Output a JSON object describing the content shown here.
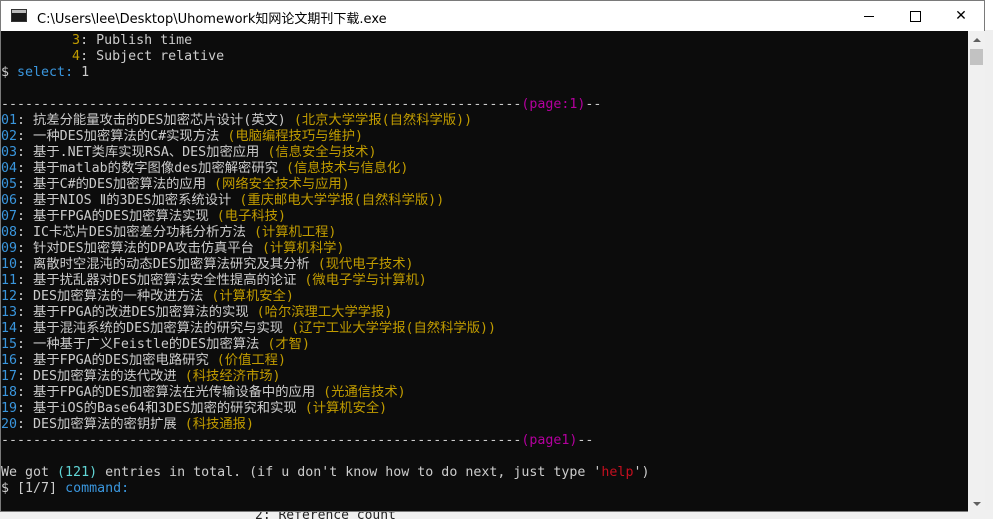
{
  "window": {
    "title": "C:\\Users\\lee\\Desktop\\Uhomework知网论文期刊下载.exe"
  },
  "console": {
    "menu": [
      {
        "num": "3",
        "text": "Publish time"
      },
      {
        "num": "4",
        "text": "Subject relative"
      }
    ],
    "prompt_symbol": "$",
    "select_label": "select:",
    "select_value": "1",
    "separator_top": {
      "dashes": "-----------------------------------------------------------------",
      "page_label": "(page:1)",
      "tail": "--"
    },
    "entries": [
      {
        "num": "01",
        "title": "抗差分能量攻击的DES加密芯片设计(英文)",
        "journal": "(北京大学学报(自然科学版))"
      },
      {
        "num": "02",
        "title": "一种DES加密算法的C#实现方法",
        "journal": "(电脑编程技巧与维护)"
      },
      {
        "num": "03",
        "title": "基于.NET类库实现RSA、DES加密应用",
        "journal": "(信息安全与技术)"
      },
      {
        "num": "04",
        "title": "基于matlab的数字图像des加密解密研究",
        "journal": "(信息技术与信息化)"
      },
      {
        "num": "05",
        "title": "基于C#的DES加密算法的应用",
        "journal": "(网络安全技术与应用)"
      },
      {
        "num": "06",
        "title": "基于NIOS Ⅱ的3DES加密系统设计",
        "journal": "(重庆邮电大学学报(自然科学版))"
      },
      {
        "num": "07",
        "title": "基于FPGA的DES加密算法实现",
        "journal": "(电子科技)"
      },
      {
        "num": "08",
        "title": "IC卡芯片DES加密差分功耗分析方法",
        "journal": "(计算机工程)"
      },
      {
        "num": "09",
        "title": "针对DES加密算法的DPA攻击仿真平台",
        "journal": "(计算机科学)"
      },
      {
        "num": "10",
        "title": "离散时空混沌的动态DES加密算法研究及其分析",
        "journal": "(现代电子技术)"
      },
      {
        "num": "11",
        "title": "基于扰乱器对DES加密算法安全性提高的论证",
        "journal": "(微电子学与计算机)"
      },
      {
        "num": "12",
        "title": "DES加密算法的一种改进方法",
        "journal": "(计算机安全)"
      },
      {
        "num": "13",
        "title": "基于FPGA的改进DES加密算法的实现",
        "journal": "(哈尔滨理工大学学报)"
      },
      {
        "num": "14",
        "title": "基于混沌系统的DES加密算法的研究与实现",
        "journal": "(辽宁工业大学学报(自然科学版))"
      },
      {
        "num": "15",
        "title": "一种基于广义Feistle的DES加密算法",
        "journal": "(才智)"
      },
      {
        "num": "16",
        "title": "基于FPGA的DES加密电路研究",
        "journal": "(价值工程)"
      },
      {
        "num": "17",
        "title": "DES加密算法的迭代改进",
        "journal": "(科技经济市场)"
      },
      {
        "num": "18",
        "title": "基于FPGA的DES加密算法在光传输设备中的应用",
        "journal": "(光通信技术)"
      },
      {
        "num": "19",
        "title": "基于iOS的Base64和3DES加密的研究和实现",
        "journal": "(计算机安全)"
      },
      {
        "num": "20",
        "title": "DES加密算法的密钥扩展",
        "journal": "(科技通报)"
      }
    ],
    "separator_bottom": {
      "dashes": "-----------------------------------------------------------------",
      "page_label": "(page1)",
      "tail": "--"
    },
    "summary": {
      "pre": "We got ",
      "count": "(121)",
      "mid": " entries in total. (if u don't know how to do next, just type '",
      "help": "help",
      "post": "')"
    },
    "command": {
      "progress": "[1/7]",
      "label": "command:"
    }
  },
  "background": {
    "partial_text": "2: Reference count"
  }
}
